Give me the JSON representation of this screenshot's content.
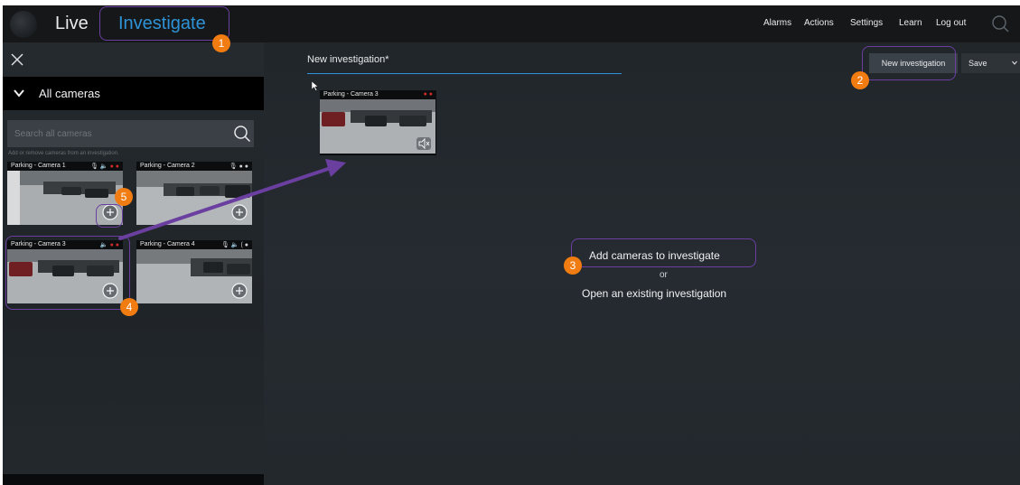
{
  "topbar": {
    "tabs": [
      {
        "label": "Live"
      },
      {
        "label": "Investigate"
      }
    ],
    "nav": [
      {
        "label": "Alarms"
      },
      {
        "label": "Actions"
      },
      {
        "label": "Settings"
      },
      {
        "label": "Learn"
      },
      {
        "label": "Log out"
      }
    ],
    "active_tab_color": "#2e93d6"
  },
  "sidebar": {
    "group_label": "All cameras",
    "search_placeholder": "Search all cameras",
    "hint": "Add or remove cameras from an investigation.",
    "cameras": [
      {
        "name": "Parking - Camera 1"
      },
      {
        "name": "Parking - Camera 2"
      },
      {
        "name": "Parking - Camera 3"
      },
      {
        "name": "Parking - Camera 4"
      }
    ]
  },
  "main": {
    "investigation_title": "New investigation*",
    "new_investigation_label": "New investigation",
    "save_label": "Save",
    "selected_camera": {
      "name": "Parking - Camera 3"
    },
    "empty_state": {
      "add": "Add cameras to investigate",
      "or": "or",
      "open": "Open an existing investigation"
    }
  },
  "annotations": {
    "badges": [
      "1",
      "2",
      "3",
      "4",
      "5"
    ],
    "badge_color": "#f07c12",
    "highlight_color": "#6b3fa0"
  }
}
